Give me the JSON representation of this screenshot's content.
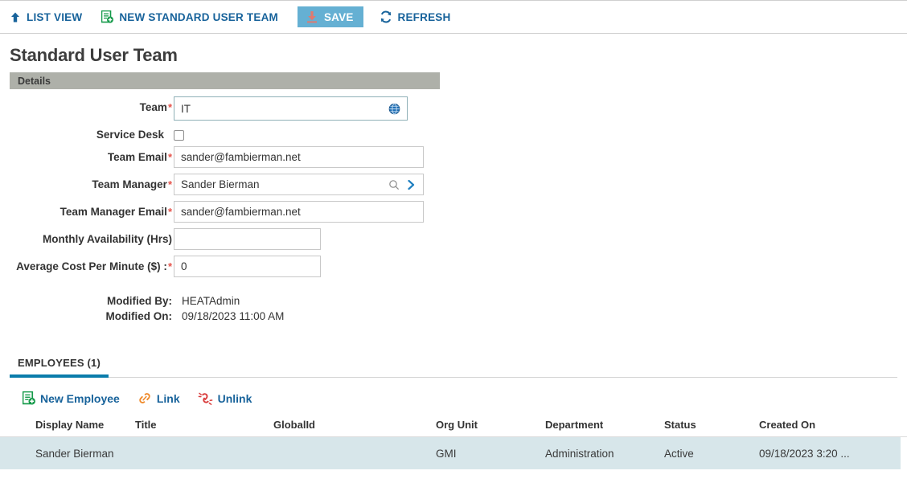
{
  "toolbar": {
    "items": [
      {
        "label": "LIST VIEW",
        "icon": "arrow-up-icon",
        "name": "list-view"
      },
      {
        "label": "NEW STANDARD USER TEAM",
        "icon": "new-document-icon",
        "name": "new-standard-user-team"
      },
      {
        "label": "SAVE",
        "icon": "save-download-icon",
        "name": "save"
      },
      {
        "label": "REFRESH",
        "icon": "refresh-icon",
        "name": "refresh"
      }
    ]
  },
  "page": {
    "title": "Standard User Team",
    "section_header": "Details"
  },
  "form": {
    "team": {
      "label": "Team",
      "required": true,
      "value": "IT",
      "icon": "globe-icon"
    },
    "service_desk": {
      "label": "Service Desk",
      "required": false,
      "checked": false
    },
    "team_email": {
      "label": "Team Email",
      "required": true,
      "value": "sander@fambierman.net"
    },
    "team_manager": {
      "label": "Team Manager",
      "required": true,
      "value": "Sander Bierman",
      "icons": [
        "search-icon",
        "chevron-right-icon"
      ]
    },
    "team_manager_email": {
      "label": "Team Manager Email",
      "required": true,
      "value": "sander@fambierman.net"
    },
    "monthly_availability": {
      "label": "Monthly Availability (Hrs)",
      "required": false,
      "value": ""
    },
    "avg_cost_per_minute": {
      "label": "Average Cost Per Minute ($) :",
      "required": true,
      "value": "0"
    }
  },
  "meta": {
    "modified_by_label": "Modified By:",
    "modified_by_value": "HEATAdmin",
    "modified_on_label": "Modified On:",
    "modified_on_value": "09/18/2023 11:00 AM"
  },
  "tabs": [
    {
      "label": "EMPLOYEES (1)",
      "active": true
    }
  ],
  "sub_toolbar": [
    {
      "label": "New Employee",
      "icon": "new-document-icon",
      "name": "new-employee"
    },
    {
      "label": "Link",
      "icon": "link-icon",
      "name": "link"
    },
    {
      "label": "Unlink",
      "icon": "unlink-icon",
      "name": "unlink"
    }
  ],
  "grid": {
    "columns": [
      "Display Name",
      "Title",
      "GlobalId",
      "Org Unit",
      "Department",
      "Status",
      "Created On"
    ],
    "rows": [
      {
        "display_name": "Sander Bierman",
        "title": "",
        "global_id": "",
        "org_unit": "GMI",
        "department": "Administration",
        "status": "Active",
        "created_on": "09/18/2023 3:20 ..."
      }
    ]
  },
  "colors": {
    "link_blue": "#18639b",
    "save_bg": "#65b0d3",
    "save_icon": "#e07a70",
    "band_gray": "#aeb0a9",
    "tab_underline": "#0a7cab",
    "row_highlight": "#d7e6ea",
    "required_red": "#e5534b",
    "green_icon": "#159a4a",
    "orange_icon": "#ef8a2b",
    "red_icon": "#d93d3d"
  }
}
